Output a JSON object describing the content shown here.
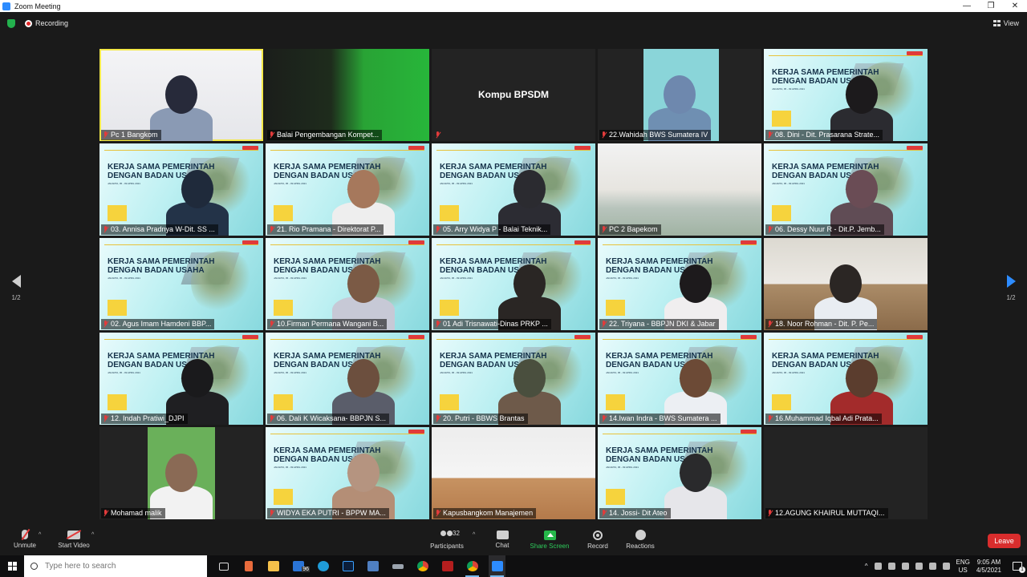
{
  "window": {
    "title": "Zoom Meeting",
    "controls": [
      "—",
      "❐",
      "✕"
    ]
  },
  "topbar": {
    "recording_label": "Recording",
    "view_label": "View"
  },
  "pagination": {
    "left": "1/2",
    "right": "1/2"
  },
  "tiles": [
    {
      "name": "Pc 1 Bangkom",
      "bg": "wall",
      "active": true,
      "person": {
        "head": "#272a3a",
        "body": "#8a9ab4"
      }
    },
    {
      "name": "Balai Pengembangan Kompet...",
      "bg": "studio"
    },
    {
      "name": "",
      "bg": "dark",
      "center": "Kompu BPSDM"
    },
    {
      "name": "22.Wahidah BWS Sumatera IV",
      "bg": "slide-dark",
      "person": {
        "head": "#6e88ae",
        "body": "#6f8fb2"
      }
    },
    {
      "name": "08. Dini - Dit. Prasarana Strate...",
      "bg": "slide",
      "person": {
        "head": "#1c1a1c",
        "body": "#2b2b30"
      }
    },
    {
      "name": "03. Annisa Pradnya W-Dit. SS ...",
      "bg": "slide",
      "person": {
        "head": "#1f2a3b",
        "body": "#233348"
      }
    },
    {
      "name": "21. Rio Pramana - Direktorat P...",
      "bg": "slide",
      "person": {
        "head": "#a6785c",
        "body": "#eeeeee"
      }
    },
    {
      "name": "05. Arry Widya P - Balai Teknik...",
      "bg": "slide",
      "person": {
        "head": "#2b2b30",
        "body": "#2c2c33"
      }
    },
    {
      "name": "PC 2 Bapekom",
      "bg": "hall"
    },
    {
      "name": "06. Dessy Nuur R - Dit.P. Jemb...",
      "bg": "slide",
      "person": {
        "head": "#6a4c55",
        "body": "#604c55"
      }
    },
    {
      "name": "02. Agus Imam Hamdeni BBP...",
      "bg": "slide"
    },
    {
      "name": "10.Firman Permana Wangani B...",
      "bg": "slide",
      "person": {
        "head": "#7b5a45",
        "body": "#c7c9d6"
      }
    },
    {
      "name": "01 Adi Trisnawati-Dinas PRKP ...",
      "bg": "slide",
      "person": {
        "head": "#2a2624",
        "body": "#2a2624"
      }
    },
    {
      "name": "22. Triyana - BBPJN DKI & Jabar",
      "bg": "slide",
      "person": {
        "head": "#1d1a1c",
        "body": "#f0eeef"
      }
    },
    {
      "name": "18. Noor Rohman - Dit. P. Pe...",
      "bg": "office",
      "person": {
        "head": "#2b2624",
        "body": "#e9edf2"
      }
    },
    {
      "name": "12. Indah Pratiwi_DJPI",
      "bg": "slide",
      "person": {
        "head": "#1a1a1c",
        "body": "#1f1f22"
      }
    },
    {
      "name": "06. Dali K Wicaksana- BBPJN S...",
      "bg": "slide",
      "person": {
        "head": "#6c4f3e",
        "body": "#5a5d6a"
      }
    },
    {
      "name": "20. Putri - BBWS Brantas",
      "bg": "slide",
      "person": {
        "head": "#4a4f3e",
        "body": "#6e5a4a"
      }
    },
    {
      "name": "14.Iwan Indra - BWS Sumatera ...",
      "bg": "slide",
      "person": {
        "head": "#6c4a36",
        "body": "#eceff3"
      }
    },
    {
      "name": "16.Muhammad Iqbal Adi Prata...",
      "bg": "slide",
      "person": {
        "head": "#5b3d2e",
        "body": "#a32b2b"
      }
    },
    {
      "name": "Mohamad malik",
      "bg": "green-dark",
      "person": {
        "head": "#8a6a55",
        "body": "#f2f2f2"
      }
    },
    {
      "name": "WIDYA EKA PUTRI - BPPW MA...",
      "bg": "slide",
      "person": {
        "head": "#b59480",
        "body": "#b48e76"
      }
    },
    {
      "name": "Kapusbangkom Manajemen",
      "bg": "room"
    },
    {
      "name": "14. Jossi- Dit Ateo",
      "bg": "slide",
      "person": {
        "head": "#2a2a2c",
        "body": "#e6e6ea"
      }
    },
    {
      "name": "12.AGUNG KHAIRUL MUTTAQI...",
      "bg": "dark"
    }
  ],
  "slide": {
    "title": "KERJA SAMA PEMERINTAH DENGAN BADAN USAHA",
    "date": "JAKARTA, 05 - 09 APRIL 2021"
  },
  "toolbar": {
    "unmute": "Unmute",
    "start_video": "Start Video",
    "participants": "Participants",
    "participant_count": "32",
    "chat": "Chat",
    "share_screen": "Share Screen",
    "record": "Record",
    "reactions": "Reactions",
    "leave": "Leave"
  },
  "taskbar": {
    "search_placeholder": "Type here to search",
    "mail_badge": "96",
    "lang_line1": "ENG",
    "lang_line2": "US",
    "time": "9:05 AM",
    "date": "4/5/2021",
    "notifications": "1"
  },
  "colors": {
    "active_border": "#f4e94a",
    "accent": "#2d8cff",
    "leave": "#d92d2d",
    "share": "#26b84a",
    "muted": "#e23b3b"
  }
}
